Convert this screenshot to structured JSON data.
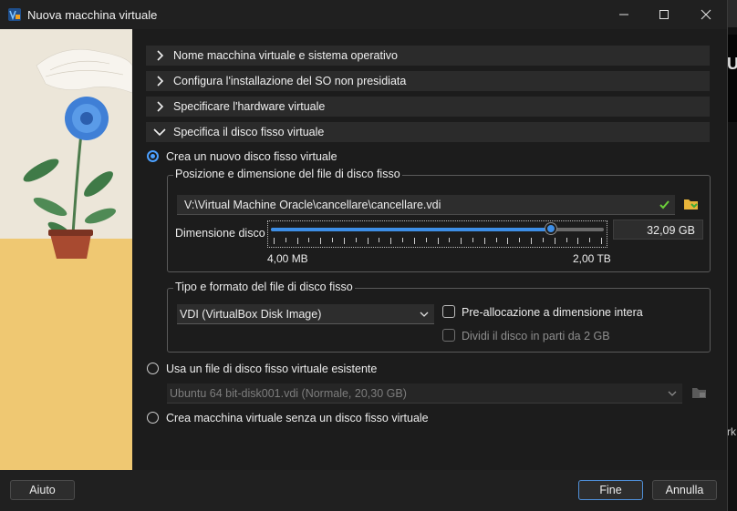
{
  "window": {
    "title": "Nuova macchina virtuale"
  },
  "sections": [
    {
      "label": "Nome macchina virtuale e sistema operativo",
      "expanded": false
    },
    {
      "label": "Configura l'installazione del SO non presidiata",
      "expanded": false
    },
    {
      "label": "Specificare l'hardware virtuale",
      "expanded": false
    },
    {
      "label": "Specifica il disco fisso virtuale",
      "expanded": true
    }
  ],
  "disk": {
    "create_option": "Crea un nuovo disco fisso virtuale",
    "location_group_title": "Posizione e dimensione del file di disco fisso",
    "path": "V:\\Virtual Machine Oracle\\cancellare\\cancellare.vdi",
    "size_label": "Dimensione disco",
    "size_value": "32,09 GB",
    "slider_fraction": 0.84,
    "slider_min_label": "4,00 MB",
    "slider_max_label": "2,00 TB",
    "format_group_title": "Tipo e formato del file di disco fisso",
    "format_selected": "VDI (VirtualBox Disk Image)",
    "prealloc_label": "Pre-allocazione a dimensione intera",
    "split_label": "Dividi il disco in parti da 2 GB",
    "existing_option": "Usa un file di disco fisso virtuale esistente",
    "existing_selected": "Ubuntu 64 bit-disk001.vdi (Normale, 20,30 GB)",
    "no_disk_option": "Crea macchina virtuale senza un disco fisso virtuale"
  },
  "buttons": {
    "help": "Aiuto",
    "finish": "Fine",
    "cancel": "Annulla"
  },
  "background_app": {
    "text1": "U",
    "text2": "rk"
  },
  "colors": {
    "accent": "#4ca0ff",
    "slider_fill": "#3d8ee6",
    "valid_check": "#6ccf3a",
    "folder": "#e8b53a"
  }
}
